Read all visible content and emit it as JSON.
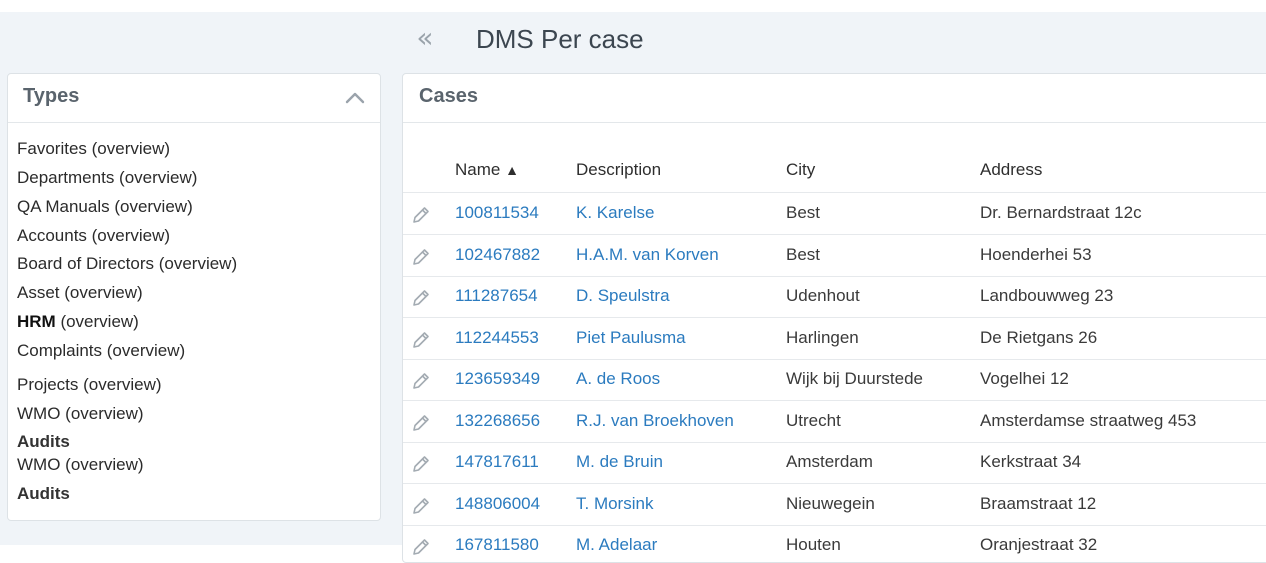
{
  "header": {
    "title": "DMS Per case",
    "collapse_glyph": "«"
  },
  "types_panel": {
    "title": "Types",
    "items": [
      {
        "label": "Favorites (overview)"
      },
      {
        "label": "Departments (overview)"
      },
      {
        "label": "QA Manuals (overview)"
      },
      {
        "label": "Accounts (overview)"
      },
      {
        "label": "Board of Directors (overview)"
      },
      {
        "label": "Asset (overview)"
      },
      {
        "label_bold": "HRM",
        "label_rest": " (overview)"
      },
      {
        "label": "Complaints (overview)"
      },
      {
        "label": "Projects (overview)"
      },
      {
        "label": "WMO (overview)"
      },
      {
        "heading": "Audits"
      },
      {
        "label": "WMO (overview)"
      },
      {
        "heading": "Audits"
      }
    ]
  },
  "cases_panel": {
    "title": "Cases",
    "columns": {
      "name": "Name",
      "sort_glyph": "▲",
      "description": "Description",
      "city": "City",
      "address": "Address"
    },
    "rows": [
      {
        "name": "100811534",
        "description": "K. Karelse",
        "city": "Best",
        "address": "Dr. Bernardstraat 12c"
      },
      {
        "name": "102467882",
        "description": "H.A.M. van Korven",
        "city": "Best",
        "address": "Hoenderhei 53"
      },
      {
        "name": "111287654",
        "description": "D. Speulstra",
        "city": "Udenhout",
        "address": "Landbouwweg 23"
      },
      {
        "name": "112244553",
        "description": "Piet Paulusma",
        "city": "Harlingen",
        "address": "De Rietgans 26"
      },
      {
        "name": "123659349",
        "description": "A. de Roos",
        "city": "Wijk bij Duurstede",
        "address": "Vogelhei 12"
      },
      {
        "name": "132268656",
        "description": "R.J. van Broekhoven",
        "city": "Utrecht",
        "address": "Amsterdamse straatweg 453"
      },
      {
        "name": "147817611",
        "description": "M. de Bruin",
        "city": "Amsterdam",
        "address": "Kerkstraat 34"
      },
      {
        "name": "148806004",
        "description": "T. Morsink",
        "city": "Nieuwegein",
        "address": "Braamstraat 12"
      },
      {
        "name": "167811580",
        "description": "M. Adelaar",
        "city": "Houten",
        "address": "Oranjestraat 32"
      }
    ]
  },
  "icons": {
    "collapse": "double-chevron-left-icon",
    "panel_toggle": "chevron-up-icon",
    "row_edit": "edit-pencil-icon"
  },
  "colors": {
    "link": "#2b7bbf",
    "background": "#f0f4f8",
    "panel_border": "#dde2e6"
  }
}
